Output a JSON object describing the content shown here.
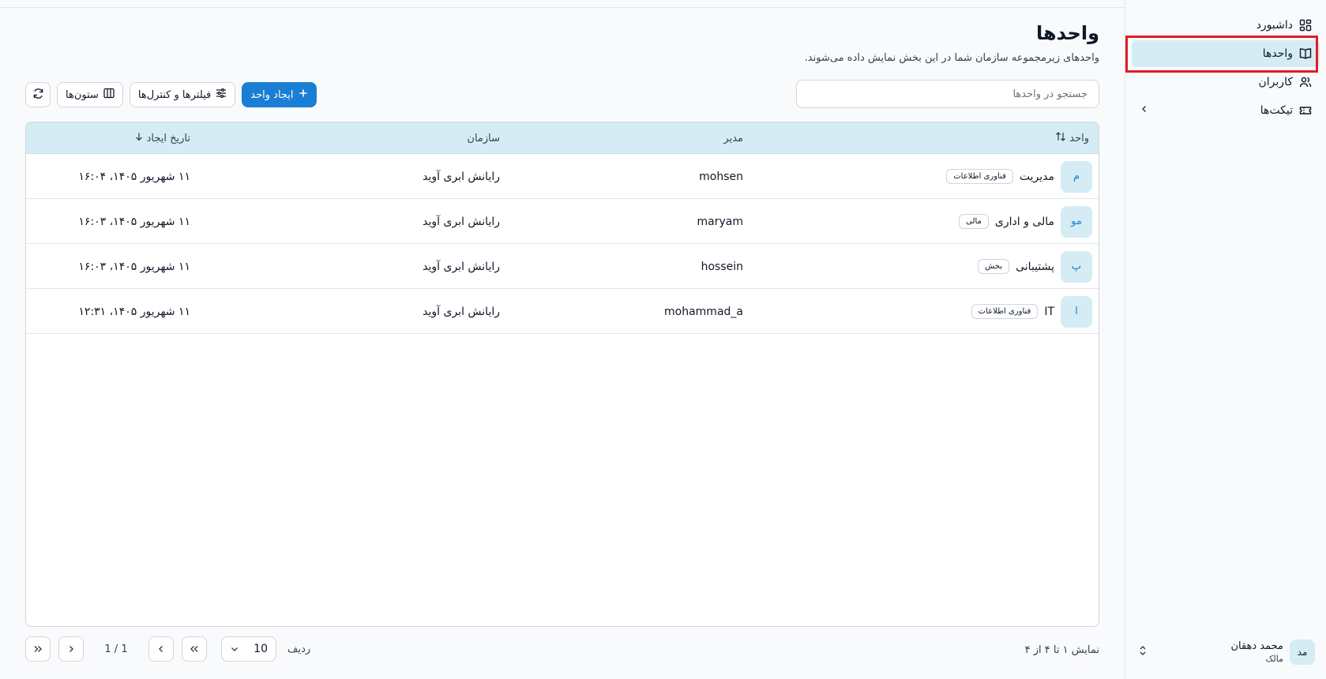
{
  "sidebar": {
    "items": [
      {
        "label": "داشبورد",
        "icon": "dashboard-icon"
      },
      {
        "label": "واحدها",
        "icon": "book-icon",
        "active": true
      },
      {
        "label": "کاربران",
        "icon": "users-icon"
      },
      {
        "label": "تیکت‌ها",
        "icon": "ticket-icon",
        "has_chevron": true
      }
    ],
    "user": {
      "initials": "مد",
      "name": "محمد دهقان",
      "role": "مالک"
    }
  },
  "header": {
    "title": "واحدها",
    "subtitle": "واحدهای زیرمجموعه سازمان شما در این بخش نمایش داده می‌شوند."
  },
  "search": {
    "placeholder": "جستجو در واحدها"
  },
  "toolbar": {
    "create_label": "ایجاد واحد",
    "filters_label": "فیلترها و کنترل‌ها",
    "columns_label": "ستون‌ها"
  },
  "table": {
    "headers": {
      "unit": "واحد",
      "manager": "مدیر",
      "organization": "سازمان",
      "created": "تاریخ ایجاد"
    },
    "rows": [
      {
        "initial": "م",
        "name": "مدیریت",
        "tag": "فناوری اطلاعات",
        "manager": "mohsen",
        "organization": "رایانش ابری آوید",
        "created": "۱۱ شهریور ۱۴۰۵، ۱۶:۰۴"
      },
      {
        "initial": "مو",
        "name": "مالی و اداری",
        "tag": "مالی",
        "manager": "maryam",
        "organization": "رایانش ابری آوید",
        "created": "۱۱ شهریور ۱۴۰۵، ۱۶:۰۳"
      },
      {
        "initial": "پ",
        "name": "پشتیبانی",
        "tag": "بخش",
        "manager": "hossein",
        "organization": "رایانش ابری آوید",
        "created": "۱۱ شهریور ۱۴۰۵، ۱۶:۰۳"
      },
      {
        "initial": "ا",
        "name": "IT",
        "tag": "فناوری اطلاعات",
        "manager": "mohammad_a",
        "organization": "رایانش ابری آوید",
        "created": "۱۱ شهریور ۱۴۰۵، ۱۲:۳۱"
      }
    ]
  },
  "footer": {
    "showing": "نمایش ۱ تا ۴ از ۴",
    "rows_label": "ردیف",
    "page_size": "10",
    "page_indicator": "1 / 1"
  },
  "colors": {
    "accent": "#1a7fd4",
    "highlight": "#d5ecf5",
    "annotation": "#e11d24"
  }
}
